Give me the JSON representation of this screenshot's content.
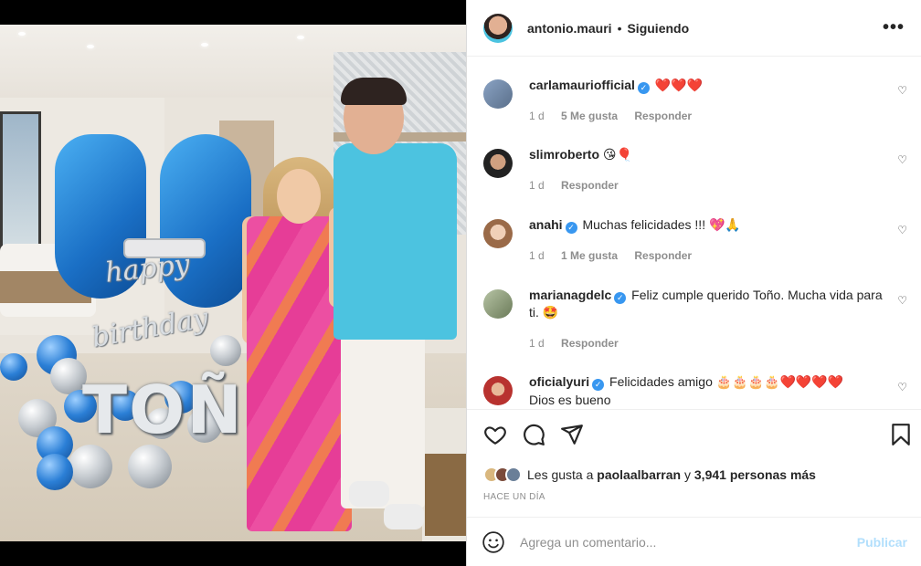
{
  "post": {
    "author": "antonio.mauri",
    "separator": "•",
    "follow_status": "Siguiendo",
    "more_icon": "more-horizontal-icon",
    "more_label": "•••"
  },
  "photo": {
    "balloon_text_1": "happy",
    "balloon_text_2": "birthday",
    "balloon_text_3": "TOÑ",
    "balloon_number": "58"
  },
  "comments": [
    {
      "user": "carlamauriofficial",
      "verified": true,
      "text": "",
      "emoji": "❤️❤️❤️",
      "time": "1 d",
      "likes": "5 Me gusta",
      "reply": "Responder",
      "avatar_color": "#5a6f8a"
    },
    {
      "user": "slimroberto",
      "verified": false,
      "text": "",
      "emoji": "😘🎈",
      "time": "1 d",
      "likes": "",
      "reply": "Responder",
      "avatar_color": "#3a3a3a"
    },
    {
      "user": "anahi",
      "verified": true,
      "text": "Muchas felicidades !!! ",
      "emoji": "💖🙏",
      "time": "1 d",
      "likes": "1 Me gusta",
      "reply": "Responder",
      "avatar_color": "#c49a7a"
    },
    {
      "user": "marianagdelc",
      "verified": true,
      "text": "Feliz cumple querido Toño. Mucha vida para ti. ",
      "emoji": "🤩",
      "time": "1 d",
      "likes": "",
      "reply": "Responder",
      "avatar_color": "#7c8a6b"
    },
    {
      "user": "oficialyuri",
      "verified": true,
      "text": "Felicidades amigo ",
      "emoji": "🎂🎂🎂🎂❤️❤️❤️❤️",
      "text2": "Dios es bueno",
      "time": "",
      "likes": "",
      "reply": "",
      "avatar_color": "#b8322f"
    }
  ],
  "actions": {
    "like_icon": "heart-icon",
    "comment_icon": "comment-icon",
    "share_icon": "paper-plane-icon",
    "save_icon": "bookmark-icon"
  },
  "likes": {
    "prefix": "Les gusta a ",
    "user": "paolaalbarran",
    "middle": " y ",
    "count": "3,941 personas más"
  },
  "timestamp": "HACE UN DÍA",
  "add_comment": {
    "placeholder": "Agrega un comentario...",
    "publish": "Publicar",
    "emoji_icon": "smiley-icon"
  },
  "colors": {
    "accent": "#0095f6",
    "verified": "#3897f0",
    "publish_disabled": "#b2dffc",
    "meta_gray": "#8e8e8e",
    "heart_red": "#e0245e"
  }
}
